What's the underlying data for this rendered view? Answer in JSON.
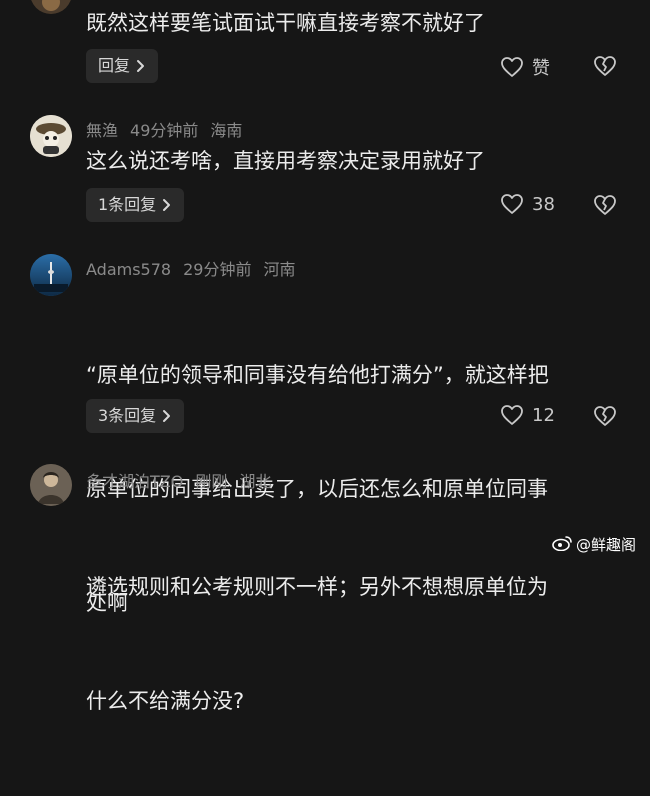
{
  "comments": [
    {
      "author": "",
      "time": "",
      "location": "",
      "text": "既然这样要笔试面试干嘛直接考察不就好了",
      "reply_label": "回复",
      "like_label": "赞"
    },
    {
      "author": "無渔",
      "time": "49分钟前",
      "location": "海南",
      "text": "这么说还考啥，直接用考察决定录用就好了",
      "reply_label": "1条回复",
      "like_label": "38"
    },
    {
      "author": "Adams578",
      "time": "29分钟前",
      "location": "河南",
      "text_lines": [
        "“原单位的领导和同事没有给他打满分”，就这样把",
        "原单位的同事给出卖了，以后还怎么和原单位同事",
        "处啊"
      ],
      "reply_label": "3条回复",
      "like_label": "12"
    },
    {
      "author": "多才湖泊TZO",
      "time": "刚刚",
      "location": "湖北",
      "text_lines": [
        "遴选规则和公考规则不一样；另外不想想原单位为",
        "什么不给满分没?"
      ]
    }
  ],
  "watermark": {
    "text": "@鲜趣阁"
  },
  "icons": {
    "reply_chevron": "chevron-right-icon",
    "like": "heart-outline-icon",
    "dislike": "broken-heart-icon",
    "weibo": "weibo-logo-icon"
  }
}
